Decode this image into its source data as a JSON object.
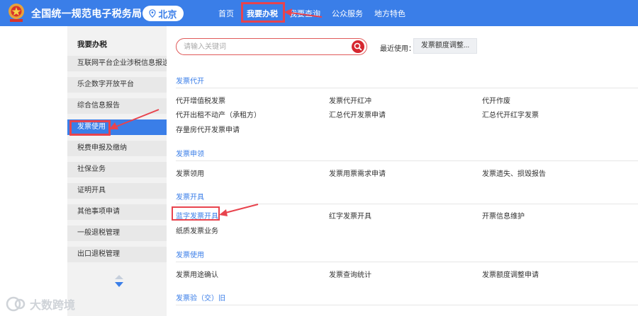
{
  "header": {
    "site_title": "全国统一规范电子税务局",
    "city": "北京",
    "nav": [
      "首页",
      "我要办税",
      "我要查询",
      "公众服务",
      "地方特色"
    ]
  },
  "sidebar": {
    "title": "我要办税",
    "items": [
      "互联网平台企业涉税信息报送",
      "乐企数字开放平台",
      "综合信息报告",
      "发票使用",
      "税费申报及缴纳",
      "社保业务",
      "证明开具",
      "其他事项申请",
      "一般退税管理",
      "出口退税管理"
    ],
    "active_index": 3
  },
  "search": {
    "placeholder": "请输入关键词",
    "recent_label": "最近使用：",
    "recent_chip": "发票额度调整..."
  },
  "sections": [
    {
      "title": "发票代开",
      "links": [
        "代开增值税发票",
        "发票代开红冲",
        "代开作废",
        "代开出租不动产（承租方）",
        "汇总代开发票申请",
        "汇总代开红字发票",
        "存量房代开发票申请"
      ]
    },
    {
      "title": "发票申领",
      "links": [
        "发票领用",
        "发票用票需求申请",
        "发票遗失、损毁报告"
      ]
    },
    {
      "title": "发票开具",
      "links": [
        "蓝字发票开具",
        "红字发票开具",
        "开票信息维护",
        "纸质发票业务"
      ]
    },
    {
      "title": "发票使用",
      "links": [
        "发票用途确认",
        "发票查询统计",
        "发票额度调整申请"
      ]
    },
    {
      "title": "发票验（交）旧",
      "links": []
    }
  ],
  "watermark": "大数跨境",
  "colors": {
    "brand_blue": "#3a7ee8",
    "highlight_red": "#e8434d"
  }
}
